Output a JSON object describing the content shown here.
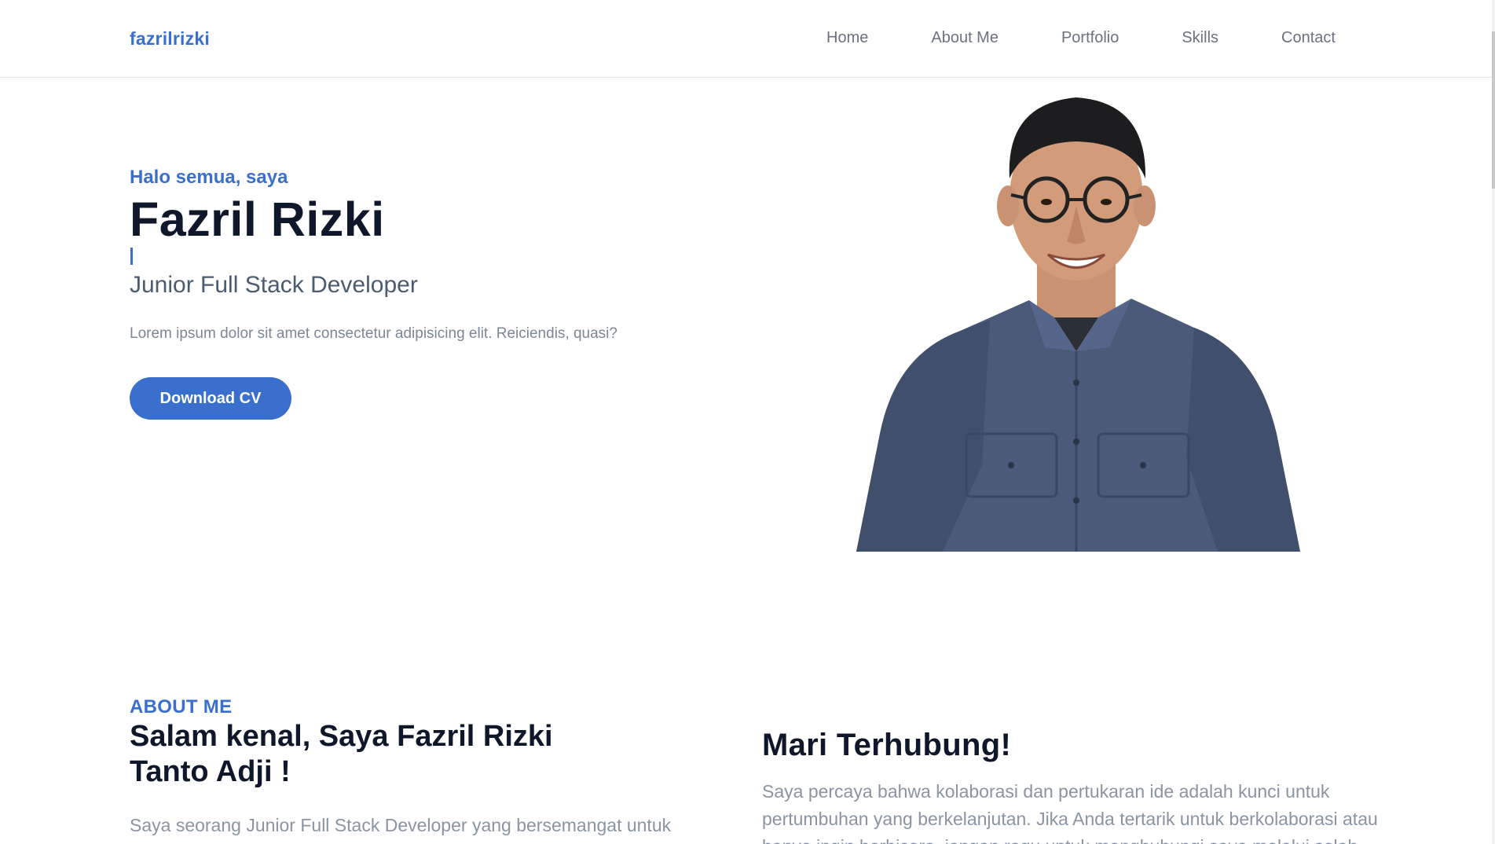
{
  "nav": {
    "brand": "fazrilrizki",
    "links": [
      "Home",
      "About Me",
      "Portfolio",
      "Skills",
      "Contact"
    ]
  },
  "hero": {
    "greeting": "Halo semua, saya",
    "name": "Fazril Rizki",
    "role": "Junior Full Stack Developer",
    "description": "Lorem ipsum dolor sit amet consectetur adipisicing elit. Reiciendis, quasi?",
    "cv_button": "Download CV"
  },
  "about": {
    "eyebrow": "ABOUT ME",
    "title": "Salam kenal, Saya Fazril Rizki Tanto Adji !",
    "text": "Saya seorang Junior Full Stack Developer yang bersemangat untuk"
  },
  "connect": {
    "title": "Mari Terhubung!",
    "text": "Saya percaya bahwa kolaborasi dan pertukaran ide adalah kunci untuk pertumbuhan yang berkelanjutan. Jika Anda tertarik untuk berkolaborasi atau hanya ingin berbicara, jangan ragu untuk menghubungi saya melalui salah"
  },
  "colors": {
    "accent": "#3b6fce",
    "heading": "#0f172a",
    "muted": "#8a94a2"
  }
}
